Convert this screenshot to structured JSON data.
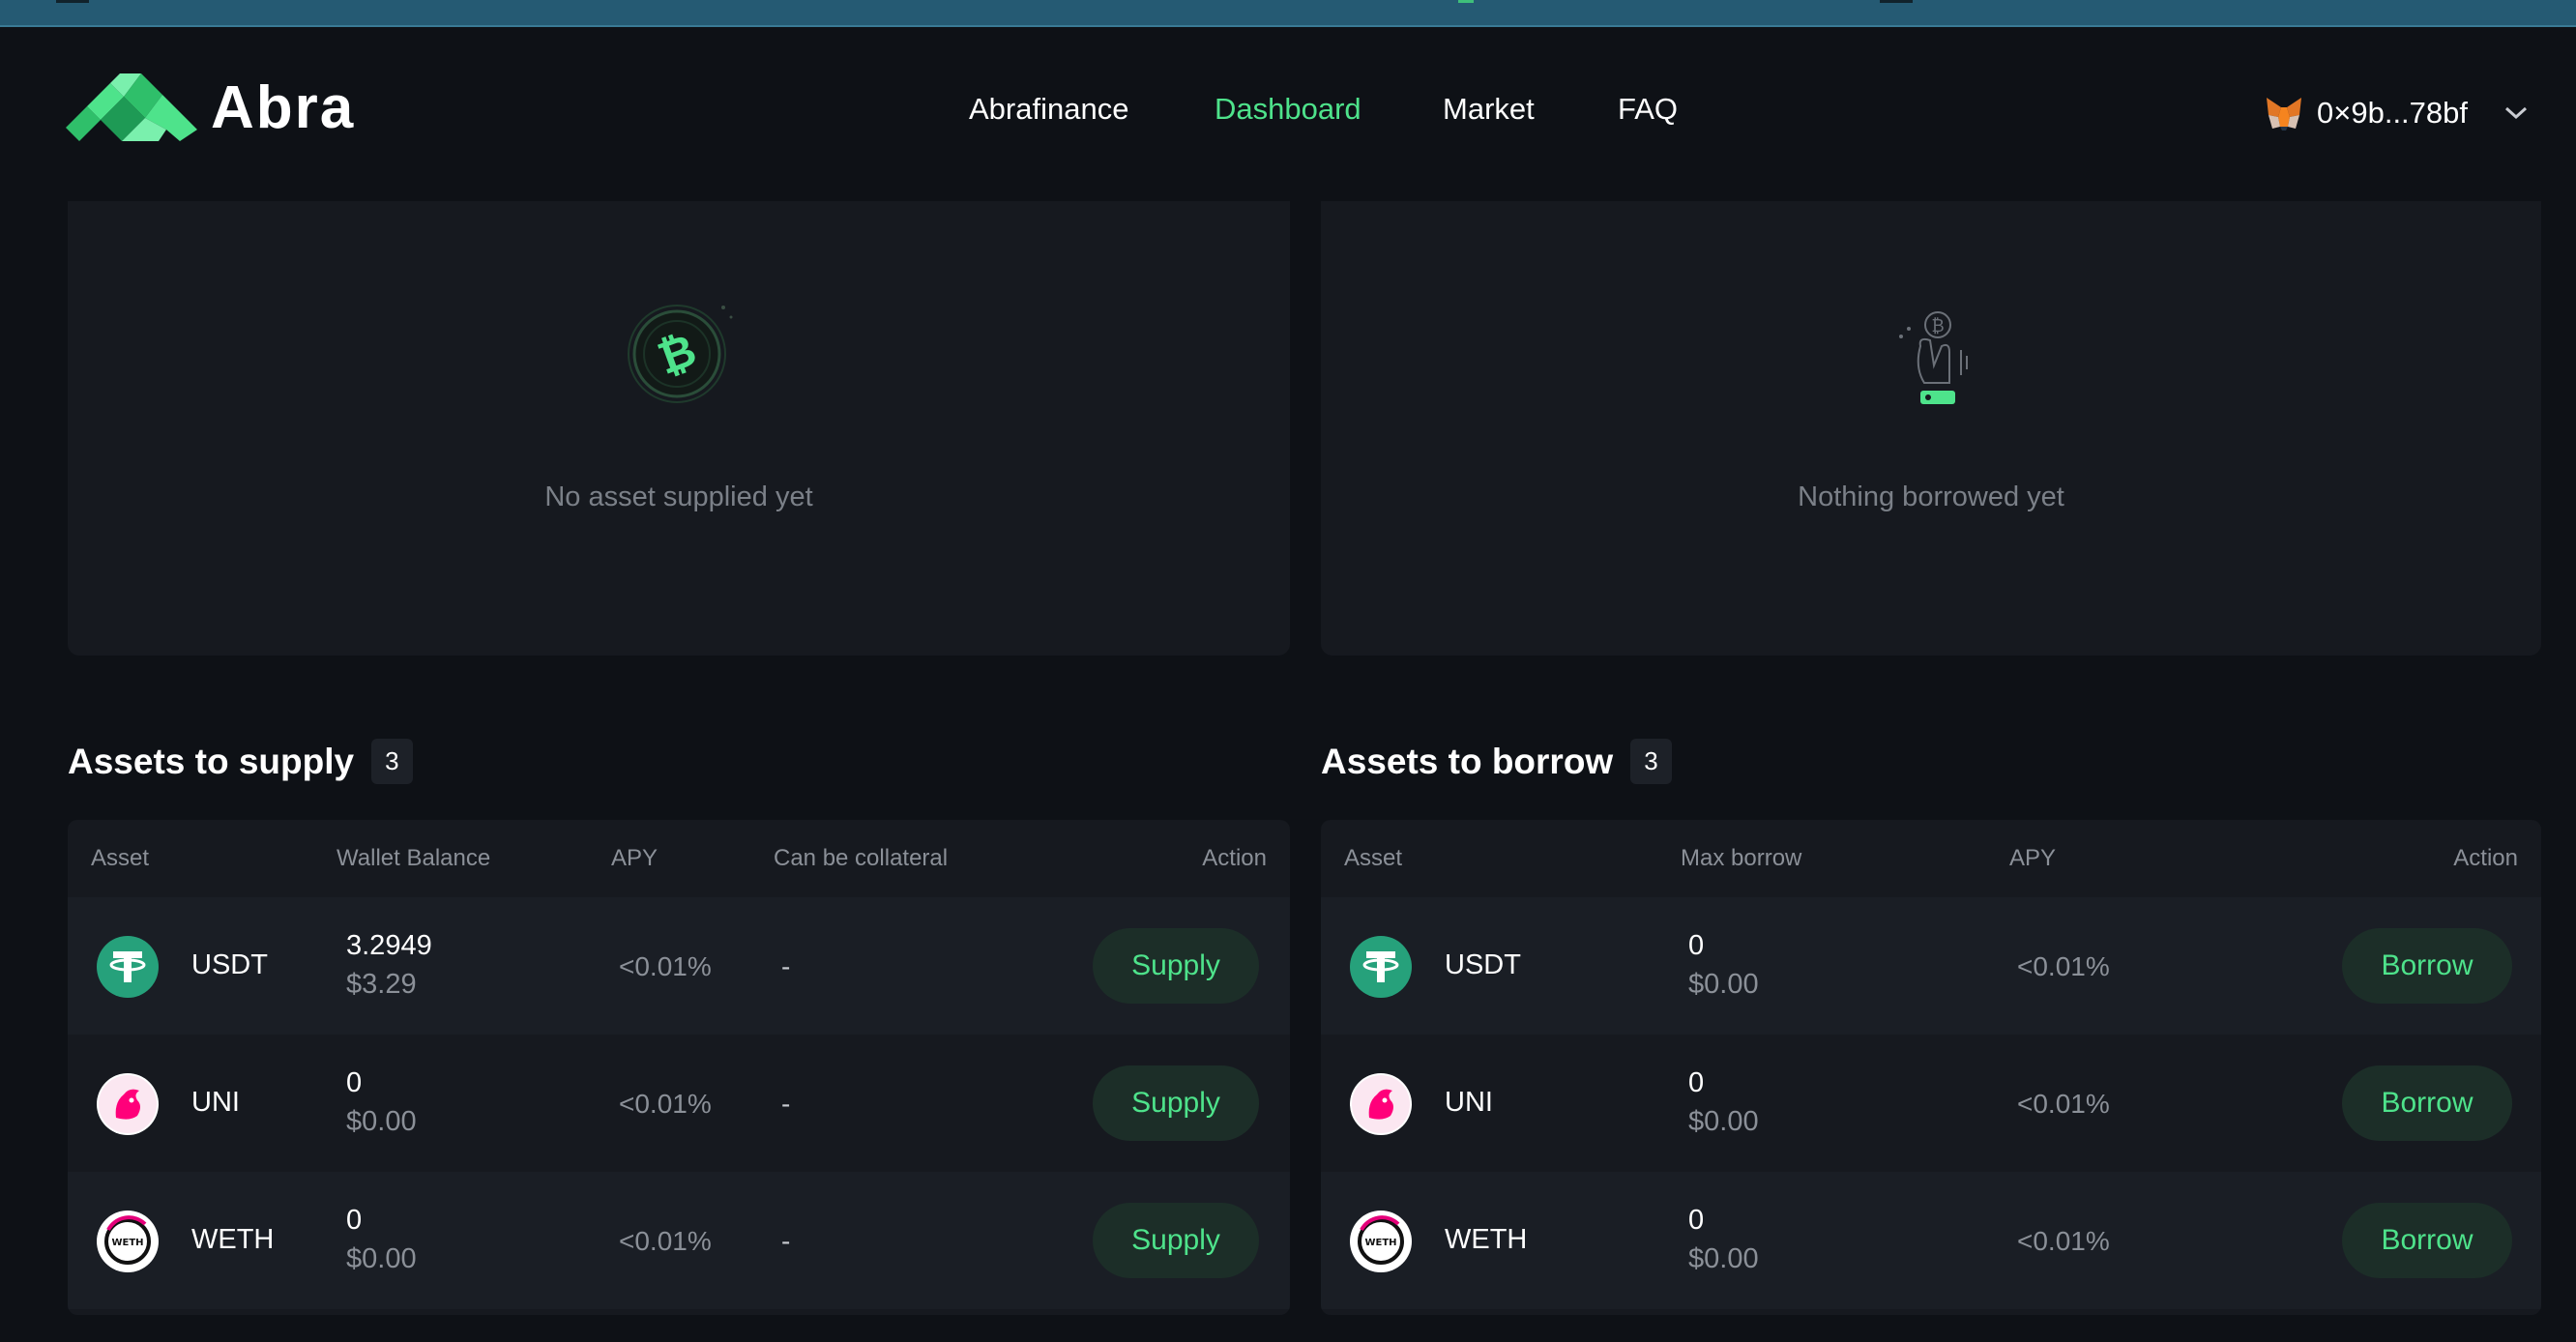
{
  "brand": {
    "name": "Abra"
  },
  "nav": {
    "items": [
      {
        "label": "Abrafinance",
        "active": false
      },
      {
        "label": "Dashboard",
        "active": true
      },
      {
        "label": "Market",
        "active": false
      },
      {
        "label": "FAQ",
        "active": false
      }
    ]
  },
  "wallet": {
    "address": "0×9b...78bf",
    "icon": "metamask-fox-icon"
  },
  "supplies": {
    "empty_text": "No asset supplied yet"
  },
  "borrows": {
    "empty_text": "Nothing borrowed yet"
  },
  "supply_table": {
    "title": "Assets to supply",
    "count": "3",
    "headers": [
      "Asset",
      "Wallet Balance",
      "APY",
      "Can be collateral",
      "Action"
    ],
    "rows": [
      {
        "asset": "USDT",
        "balance": "3.2949",
        "usd": "$3.29",
        "apy": "<0.01%",
        "collateral": "-",
        "action": "Supply"
      },
      {
        "asset": "UNI",
        "balance": "0",
        "usd": "$0.00",
        "apy": "<0.01%",
        "collateral": "-",
        "action": "Supply"
      },
      {
        "asset": "WETH",
        "balance": "0",
        "usd": "$0.00",
        "apy": "<0.01%",
        "collateral": "-",
        "action": "Supply"
      }
    ]
  },
  "borrow_table": {
    "title": "Assets to borrow",
    "count": "3",
    "headers": [
      "Asset",
      "Max borrow",
      "APY",
      "Action"
    ],
    "rows": [
      {
        "asset": "USDT",
        "max": "0",
        "usd": "$0.00",
        "apy": "<0.01%",
        "action": "Borrow"
      },
      {
        "asset": "UNI",
        "max": "0",
        "usd": "$0.00",
        "apy": "<0.01%",
        "action": "Borrow"
      },
      {
        "asset": "WETH",
        "max": "0",
        "usd": "$0.00",
        "apy": "<0.01%",
        "action": "Borrow"
      }
    ]
  },
  "colors": {
    "accent": "#4ee38b",
    "background": "#0e1116",
    "panel": "#16191f",
    "usdt": "#26a17b",
    "uni": "#ff007a"
  }
}
